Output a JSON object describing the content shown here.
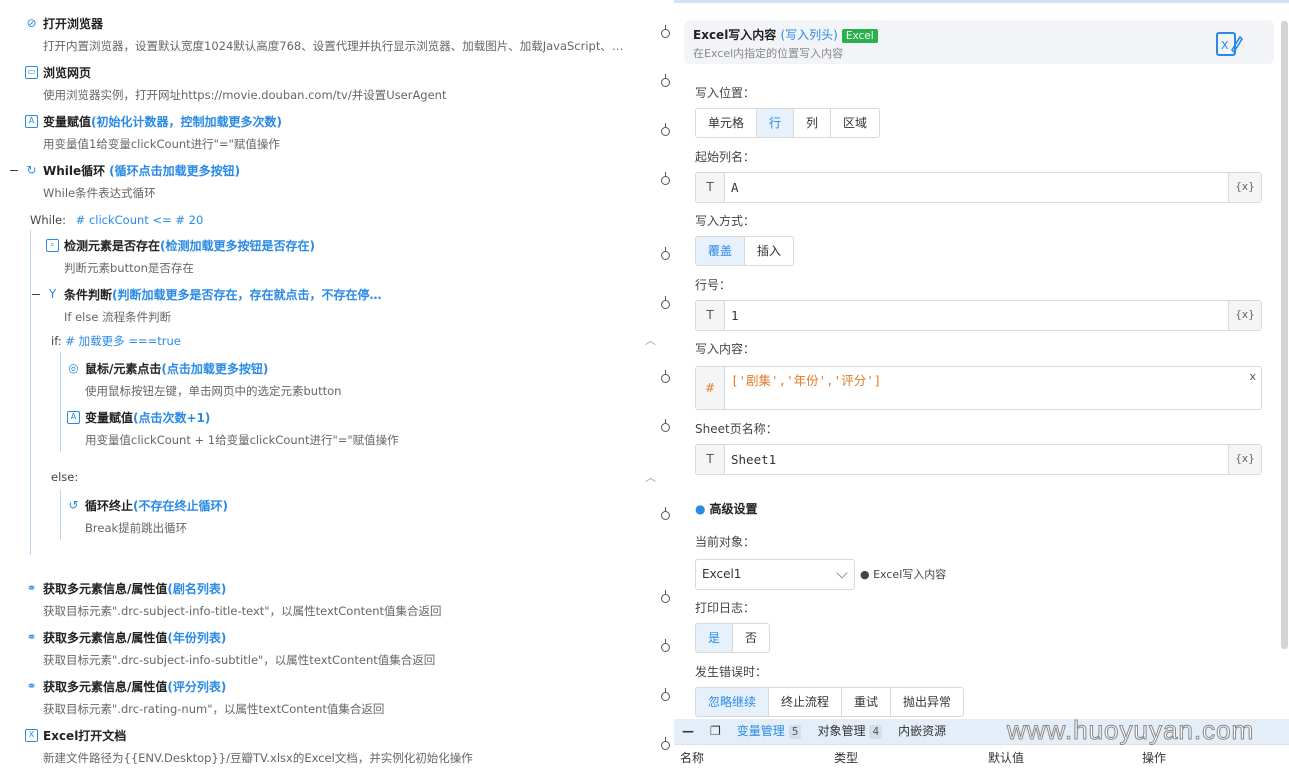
{
  "flow": {
    "s1": {
      "title": "打开浏览器",
      "desc": "打开内置浏览器，设置默认宽度1024默认高度768、设置代理并执行显示浏览器、加载图片、加载JavaScript、…"
    },
    "s2": {
      "title": "浏览网页",
      "desc": "使用浏览器实例，打开网址https://movie.douban.com/tv/并设置UserAgent"
    },
    "s3": {
      "title": "变量赋值",
      "comment": "(初始化计数器，控制加载更多次数)",
      "desc": "用变量值1给变量clickCount进行\"=\"赋值操作"
    },
    "s4": {
      "title": "While循环",
      "comment": "(循环点击加载更多按钮)",
      "desc": "While条件表达式循环"
    },
    "while_label": "While:",
    "while_cond": "# clickCount <= # 20",
    "s5": {
      "title": "检测元素是否存在",
      "comment": "(检测加载更多按钮是否存在)",
      "desc": "判断元素button是否存在"
    },
    "s6": {
      "title": "条件判断",
      "comment": "(判断加载更多是否存在，存在就点击，不存在停…",
      "desc": "If else 流程条件判断"
    },
    "if_label": "if:",
    "if_cond": "# 加载更多 ===true",
    "s7": {
      "title": "鼠标/元素点击",
      "comment": "(点击加载更多按钮)",
      "desc": "使用鼠标按钮左键，单击网页中的选定元素button"
    },
    "s8": {
      "title": "变量赋值",
      "comment": "(点击次数+1)",
      "desc": "用变量值clickCount + 1给变量clickCount进行\"=\"赋值操作"
    },
    "else_label": "else:",
    "s9": {
      "title": "循环终止",
      "comment": "(不存在终止循环)",
      "desc": "Break提前跳出循环"
    },
    "s10": {
      "title": "获取多元素信息/属性值",
      "comment": "(剧名列表)",
      "desc": "获取目标元素\".drc-subject-info-title-text\"，以属性textContent值集合返回"
    },
    "s11": {
      "title": "获取多元素信息/属性值",
      "comment": "(年份列表)",
      "desc": "获取目标元素\".drc-subject-info-subtitle\"，以属性textContent值集合返回"
    },
    "s12": {
      "title": "获取多元素信息/属性值",
      "comment": "(评分列表)",
      "desc": "获取目标元素\".drc-rating-num\"，以属性textContent值集合返回"
    },
    "s13": {
      "title": "Excel打开文档",
      "desc": "新建文件路径为{{ENV.Desktop}}/豆瓣TV.xlsx的Excel文档，并实例化初始化操作"
    }
  },
  "panel": {
    "title": "Excel写入内容",
    "comment": "(写入列头)",
    "tag": "Excel",
    "desc": "在Excel内指定的位置写入内容",
    "write_pos_label": "写入位置：",
    "write_pos_opts": [
      "单元格",
      "行",
      "列",
      "区域"
    ],
    "start_col_label": "起始列名：",
    "start_col_value": "A",
    "write_mode_label": "写入方式：",
    "write_mode_opts": [
      "覆盖",
      "插入"
    ],
    "row_label": "行号：",
    "row_value": "1",
    "content_label": "写入内容：",
    "content_value": "['剧集','年份','评分']",
    "sheet_label": "Sheet页名称：",
    "sheet_value": "Sheet1",
    "type_prefix": "T",
    "expr_prefix": "#",
    "var_suffix": "{x}",
    "clear": "x",
    "advanced": "高级设置",
    "cur_obj_label": "当前对象：",
    "cur_obj_value": "Excel1",
    "cur_obj_note": "Excel写入内容",
    "log_label": "打印日志：",
    "log_opts": [
      "是",
      "否"
    ],
    "err_label": "发生错误时：",
    "err_opts": [
      "忽略继续",
      "终止流程",
      "重试",
      "抛出异常"
    ]
  },
  "bottom": {
    "tabs": [
      {
        "label": "变量管理",
        "count": "5"
      },
      {
        "label": "对象管理",
        "count": "4"
      },
      {
        "label": "内嵌资源",
        "count": ""
      }
    ],
    "cols": [
      "名称",
      "类型",
      "默认值",
      "操作"
    ]
  },
  "watermark": "www.huoyuyan.com",
  "colors": {
    "accent": "#2a8ae6",
    "tag": "#28b04a",
    "expr": "#e07b2a"
  }
}
